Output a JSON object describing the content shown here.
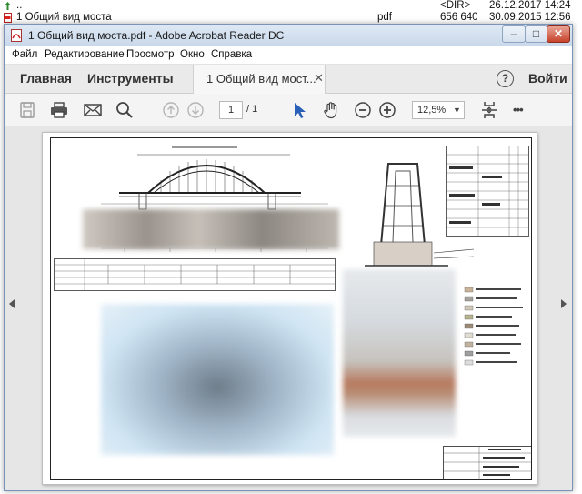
{
  "file_list": [
    {
      "name": "..",
      "ext": "",
      "size": "<DIR>",
      "date": "26.12.2017 14:24"
    },
    {
      "name": "1 Общий вид моста",
      "ext": "pdf",
      "size": "656 640",
      "date": "30.09.2015 12:56"
    }
  ],
  "window": {
    "title": "1 Общий вид моста.pdf - Adobe Acrobat Reader DC",
    "minimize": "–",
    "maximize": "□",
    "close": "✕"
  },
  "menu": [
    "Файл",
    "Редактирование",
    "Просмотр",
    "Окно",
    "Справка"
  ],
  "tabs": {
    "home": "Главная",
    "tools": "Инструменты",
    "document": "1 Общий вид мост...",
    "close": "✕",
    "help": "?",
    "login": "Войти"
  },
  "toolbar": {
    "page_current": "1",
    "page_total": "/ 1",
    "zoom": "12,5%",
    "zoom_caret": "▼",
    "more": "•••"
  },
  "colors": {
    "accent_blue": "#2a5fb8",
    "titlebar": "#c9d8ea",
    "close_red": "#c7432b"
  },
  "icons": [
    "save-icon",
    "print-icon",
    "email-icon",
    "search-icon",
    "page-up-icon",
    "page-down-icon",
    "select-arrow-icon",
    "hand-icon",
    "zoom-out-icon",
    "zoom-in-icon",
    "fit-page-icon",
    "more-icon"
  ]
}
